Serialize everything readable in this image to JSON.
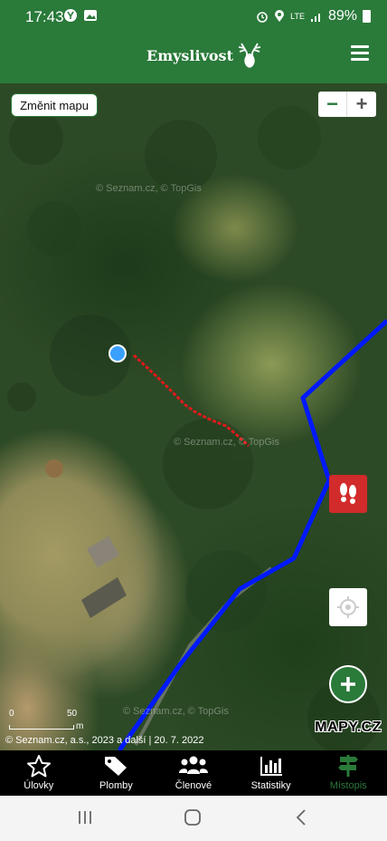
{
  "status_bar": {
    "time": "17:43",
    "battery": "89%",
    "network": "LTE"
  },
  "header": {
    "app_name": "Emyslivost",
    "brand_color": "#2a7a3a",
    "menu_icon": "hamburger-menu-icon"
  },
  "map": {
    "change_map_label": "Změnit mapu",
    "zoom_out_label": "−",
    "zoom_in_label": "+",
    "watermark": "© Seznam.cz, © TopGis",
    "scale_start": "0",
    "scale_end": "50",
    "scale_unit": "m",
    "attribution": "© Seznam.cz, a.s., 2023 a další | 20. 7. 2022",
    "provider_logo": "MAPY.CZ",
    "track_color": "#e01a1a",
    "route_color": "#0019ff",
    "location_color": "#3aa0ff"
  },
  "bottom_nav": {
    "items": [
      {
        "label": "Úlovky",
        "icon": "star-icon"
      },
      {
        "label": "Plomby",
        "icon": "tag-icon"
      },
      {
        "label": "Členové",
        "icon": "members-icon"
      },
      {
        "label": "Statistiky",
        "icon": "bar-chart-icon"
      },
      {
        "label": "Místopis",
        "icon": "signpost-icon"
      }
    ],
    "active_index": 4
  }
}
